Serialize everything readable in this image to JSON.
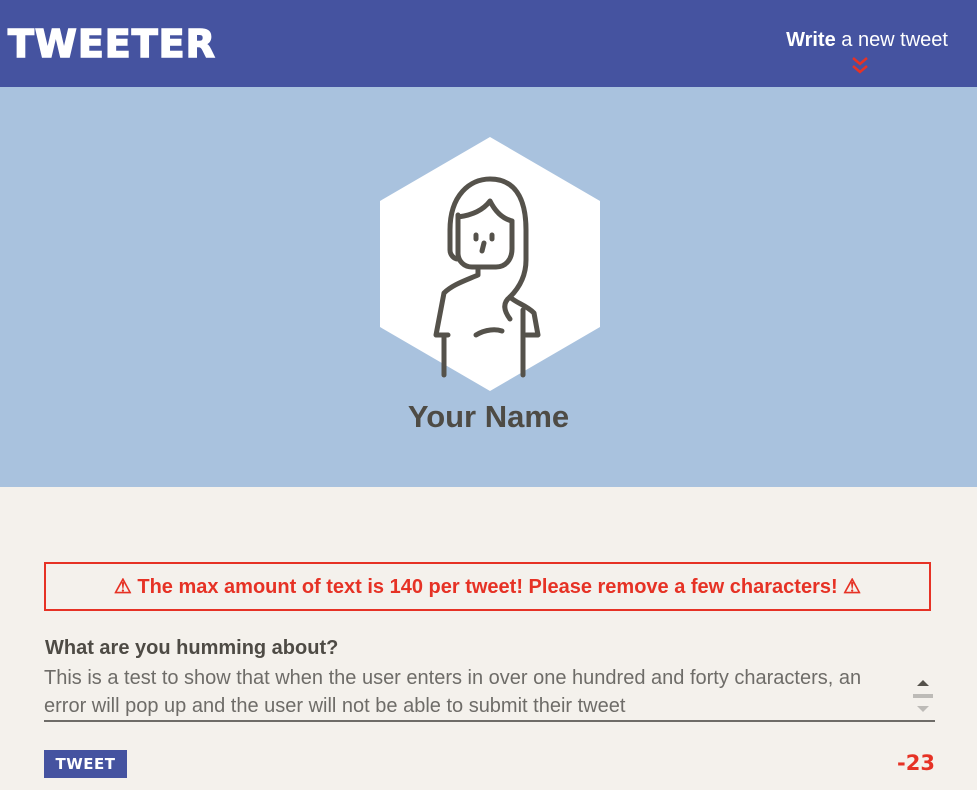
{
  "nav": {
    "logo": "TWEETER",
    "compose_bold": "Write",
    "compose_rest": " a new tweet",
    "chevron_icon": "double-chevron-down-icon"
  },
  "profile": {
    "name": "Your Name",
    "avatar_icon": "user-avatar-icon",
    "background_color": "#a9c2de"
  },
  "error": {
    "message": "⚠ The max amount of text is 140 per tweet! Please remove a few characters! ⚠",
    "color": "#e63225"
  },
  "form": {
    "label": "What are you humming about?",
    "value": "This is a test to show that when the user enters in over one hundred and forty characters, an error will pop up and the user will not be able to submit their tweet",
    "submit_label": "TWEET",
    "counter": "-23"
  },
  "colors": {
    "nav": "#4553a0",
    "page": "#f4f1ec",
    "text": "#4e4b45"
  }
}
